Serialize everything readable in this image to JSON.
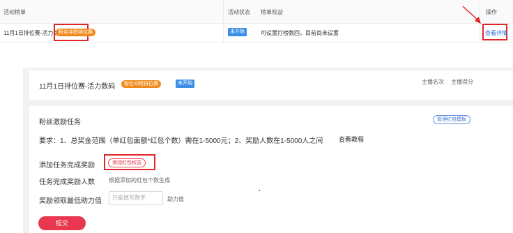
{
  "table": {
    "headers": {
      "name": "活动榜单",
      "status": "活动状态",
      "permission": "榜单权益",
      "actions": "操作"
    },
    "row": {
      "name": "11月1日排位赛-活力数码",
      "tag": "粉丝冲榜排位赛",
      "status": "未开始",
      "permission": "可设置打榜数回，目前尚未设置",
      "action_link": "查看详情"
    }
  },
  "activity_card": {
    "title": "11月1日排位赛-活力数码",
    "tag": "粉丝冲榜排位赛",
    "status": "未开始",
    "right_labels": [
      "主播名次",
      "主播得分"
    ]
  },
  "incentive_card": {
    "title": "粉丝激励任务",
    "manage_button": "管理红包模板",
    "requirement": "要求：1、总奖金范围（单红包面额*红包个数）需在1-5000元；2、奖励人数在1-5000人之间",
    "tutorial_link": "查看教程",
    "add_reward_label": "添加任务完成奖励",
    "add_redpacket_button": "添加红包权益",
    "reward_count_label": "任务完成奖励人数",
    "reward_count_hint": "根据添加的红包个数生成",
    "min_assist_label": "奖励领取最低助力值",
    "min_assist_placeholder": "只能填写数字",
    "min_assist_unit": "助力值",
    "submit_button": "提交"
  },
  "colors": {
    "accent_red": "#e8384f",
    "tag_orange": "#f08a1c",
    "status_blue": "#3a8ee6",
    "annotation_red": "#e0262a",
    "link_blue": "#2f6fd6"
  }
}
